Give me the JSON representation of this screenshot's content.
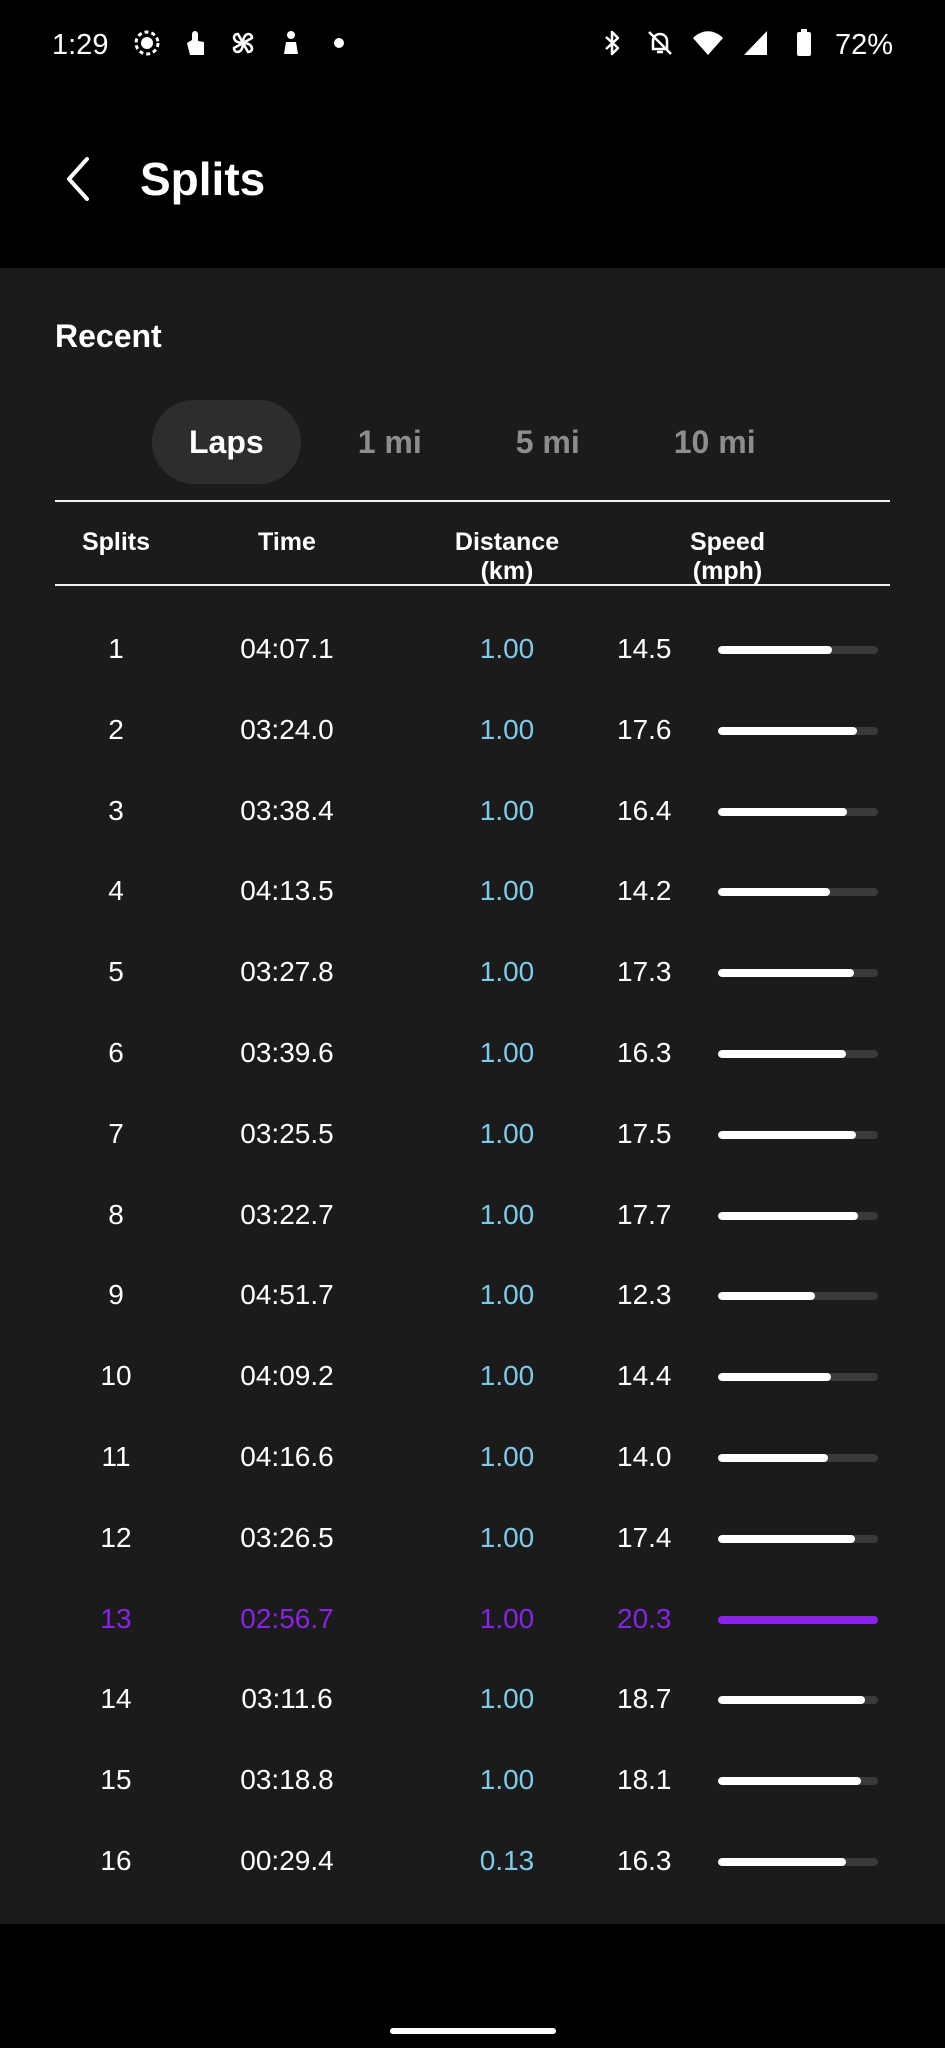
{
  "status_bar": {
    "time": "1:29",
    "left_icons": [
      "signal-app-icon",
      "tap-gesture-icon",
      "pinwheel-icon",
      "touch-icon",
      "dot-icon"
    ],
    "right_icons": [
      "bluetooth-icon",
      "notifications-off-icon",
      "wifi-icon",
      "cell-signal-icon",
      "battery-icon"
    ],
    "battery": "72%"
  },
  "header": {
    "title": "Splits"
  },
  "section": {
    "title": "Recent"
  },
  "tabs": [
    {
      "label": "Laps",
      "active": true
    },
    {
      "label": "1 mi",
      "active": false
    },
    {
      "label": "5 mi",
      "active": false
    },
    {
      "label": "10 mi",
      "active": false
    }
  ],
  "columns": {
    "splits": "Splits",
    "time": "Time",
    "distance": "Distance",
    "distance_unit": "(km)",
    "speed": "Speed",
    "speed_unit": "(mph)"
  },
  "rows": [
    {
      "split": "1",
      "time": "04:07.1",
      "distance": "1.00",
      "speed": "14.5"
    },
    {
      "split": "2",
      "time": "03:24.0",
      "distance": "1.00",
      "speed": "17.6"
    },
    {
      "split": "3",
      "time": "03:38.4",
      "distance": "1.00",
      "speed": "16.4"
    },
    {
      "split": "4",
      "time": "04:13.5",
      "distance": "1.00",
      "speed": "14.2"
    },
    {
      "split": "5",
      "time": "03:27.8",
      "distance": "1.00",
      "speed": "17.3"
    },
    {
      "split": "6",
      "time": "03:39.6",
      "distance": "1.00",
      "speed": "16.3"
    },
    {
      "split": "7",
      "time": "03:25.5",
      "distance": "1.00",
      "speed": "17.5"
    },
    {
      "split": "8",
      "time": "03:22.7",
      "distance": "1.00",
      "speed": "17.7"
    },
    {
      "split": "9",
      "time": "04:51.7",
      "distance": "1.00",
      "speed": "12.3"
    },
    {
      "split": "10",
      "time": "04:09.2",
      "distance": "1.00",
      "speed": "14.4"
    },
    {
      "split": "11",
      "time": "04:16.6",
      "distance": "1.00",
      "speed": "14.0"
    },
    {
      "split": "12",
      "time": "03:26.5",
      "distance": "1.00",
      "speed": "17.4"
    },
    {
      "split": "13",
      "time": "02:56.7",
      "distance": "1.00",
      "speed": "20.3",
      "highlight": true
    },
    {
      "split": "14",
      "time": "03:11.6",
      "distance": "1.00",
      "speed": "18.7"
    },
    {
      "split": "15",
      "time": "03:18.8",
      "distance": "1.00",
      "speed": "18.1"
    },
    {
      "split": "16",
      "time": "00:29.4",
      "distance": "0.13",
      "speed": "16.3"
    }
  ],
  "colors": {
    "background": "#000000",
    "panel": "#1b1b1b",
    "distance": "#7bcbea",
    "highlight": "#8a22e8"
  }
}
